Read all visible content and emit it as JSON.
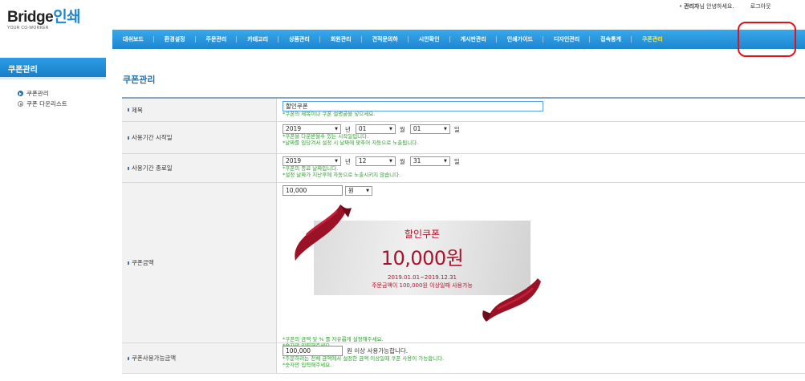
{
  "header": {
    "logo_main": "Bridge",
    "logo_accent": "인쇄",
    "logo_tagline": "YOUR CO-WORKER",
    "admin_label": "관리자",
    "greeting": "님 안녕하세요.",
    "logout": "로그아웃"
  },
  "nav": {
    "items": [
      "대쉬보드",
      "환경설정",
      "주문관리",
      "카테고리",
      "상품관리",
      "회원관리",
      "견적문의하",
      "시안확인",
      "게시판관리",
      "인쇄가이드",
      "디자인관리",
      "접속통계",
      "쿠폰관리"
    ],
    "active_index": 12
  },
  "sidebar": {
    "title": "쿠폰관리",
    "items": [
      "쿠폰관리",
      "쿠폰 다운리스트"
    ]
  },
  "page": {
    "title": "쿠폰관리"
  },
  "form": {
    "name": {
      "label": "제목",
      "value": "할인쿠폰",
      "hint": "*쿠폰의 제목이나 쿠폰 설명글을 넣으세요."
    },
    "start": {
      "label": "사용기간 시작일",
      "year": "2019",
      "year_unit": "년",
      "month": "01",
      "month_unit": "월",
      "day": "01",
      "day_unit": "일",
      "hint1": "*쿠폰을 다운받을수 있는 시작일입니다.",
      "hint2": "*날짜를 임당겨서 설정 시 날짜에 맞추어 자동으로 노출됩니다."
    },
    "end": {
      "label": "사용기간 종료일",
      "year": "2019",
      "year_unit": "년",
      "month": "12",
      "month_unit": "월",
      "day": "31",
      "day_unit": "일",
      "hint1": "*쿠폰의 종료 날짜입니다.",
      "hint2": "*설정 날짜가 지난후에 자동으로 노출시키지 않습니다."
    },
    "amount": {
      "label": "쿠폰금액",
      "value": "10,000",
      "unit": "원",
      "hint1": "*쿠폰의 금액 및 % 를 자유롭게 설정해주세요.",
      "hint2": "*숫자만 입력해주세요."
    },
    "min_purchase": {
      "label": "쿠폰사용가능금액",
      "value": "100,000",
      "suffix": "원 이상 사용가능합니다.",
      "hint1": "*주문하려는 전체 금액에서 설정한 금액 이상일때 쿠폰 사용이 가능합니다.",
      "hint2": "*숫자만 입력해주세요."
    }
  },
  "coupon_preview": {
    "title": "할인쿠폰",
    "amount": "10,000원",
    "period": "2019.01.01~2019.12.31",
    "condition": "주문금액이 100,000원 이상일때 사용가능"
  },
  "colors": {
    "nav_blue": "#1d86d1",
    "active_nav": "#ffea3d",
    "highlight_ring": "#e2121b",
    "hint_green": "#2e9b2e",
    "coupon_red": "#a8142b"
  }
}
